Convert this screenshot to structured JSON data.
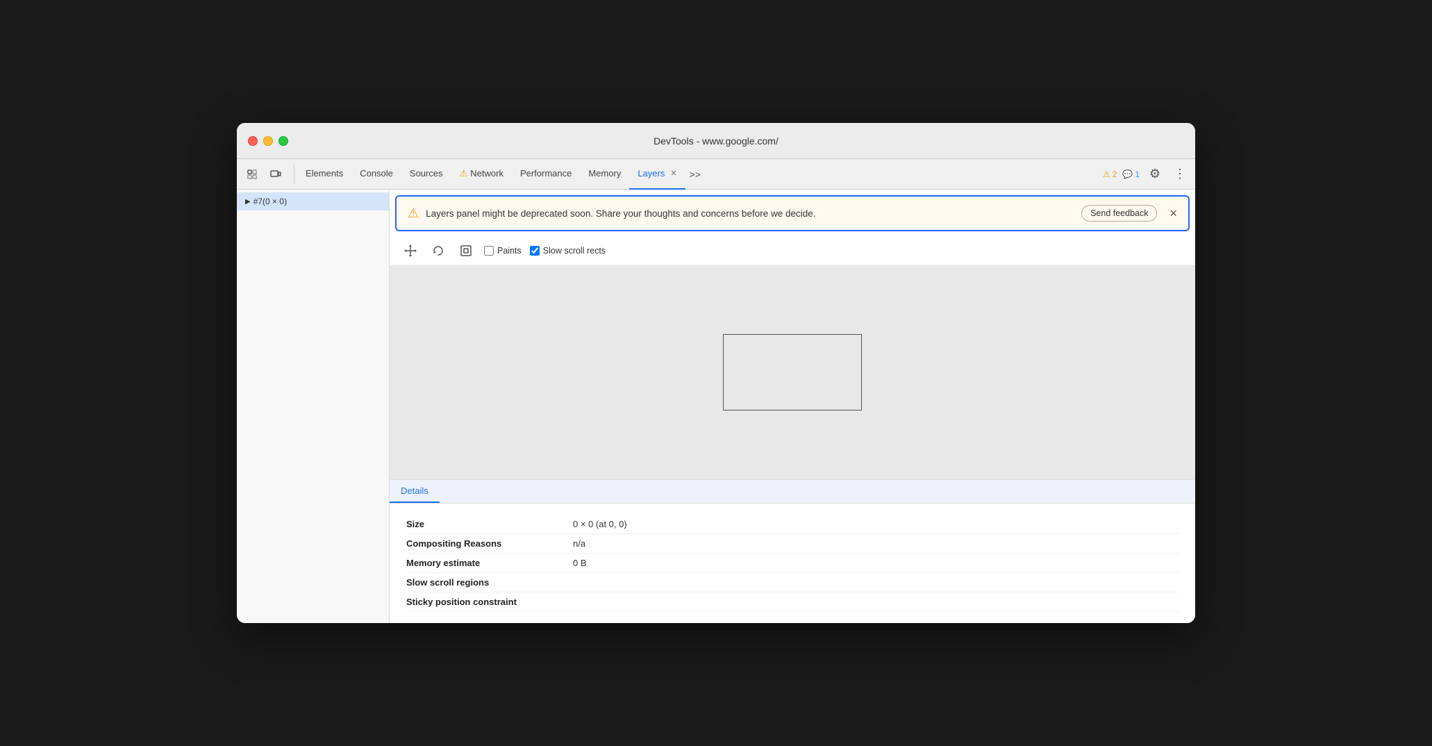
{
  "window": {
    "title": "DevTools - www.google.com/"
  },
  "tabs": {
    "items": [
      {
        "id": "elements",
        "label": "Elements",
        "active": false,
        "warning": false
      },
      {
        "id": "console",
        "label": "Console",
        "active": false,
        "warning": false
      },
      {
        "id": "sources",
        "label": "Sources",
        "active": false,
        "warning": false
      },
      {
        "id": "network",
        "label": "Network",
        "active": false,
        "warning": true
      },
      {
        "id": "performance",
        "label": "Performance",
        "active": false,
        "warning": false
      },
      {
        "id": "memory",
        "label": "Memory",
        "active": false,
        "warning": false
      },
      {
        "id": "layers",
        "label": "Layers",
        "active": true,
        "warning": false
      }
    ],
    "overflow_label": ">>",
    "warning_count": "2",
    "info_count": "1"
  },
  "sidebar": {
    "items": [
      {
        "id": "layer1",
        "label": "#7(0 × 0)",
        "selected": true
      }
    ]
  },
  "banner": {
    "text": "Layers panel might be deprecated soon. Share your thoughts and concerns before we decide.",
    "send_feedback_label": "Send feedback",
    "close_label": "×"
  },
  "layers_toolbar": {
    "tools": [
      {
        "id": "pan",
        "icon": "⊕",
        "label": "Pan"
      },
      {
        "id": "rotate",
        "icon": "↻",
        "label": "Rotate"
      },
      {
        "id": "reset",
        "icon": "⊡",
        "label": "Reset transform"
      }
    ],
    "paints_label": "Paints",
    "paints_checked": false,
    "slow_scroll_label": "Slow scroll rects",
    "slow_scroll_checked": true
  },
  "details": {
    "tab_label": "Details",
    "rows": [
      {
        "key": "Size",
        "value": "0 × 0 (at 0, 0)"
      },
      {
        "key": "Compositing Reasons",
        "value": "n/a"
      },
      {
        "key": "Memory estimate",
        "value": "0 B"
      },
      {
        "key": "Slow scroll regions",
        "value": ""
      },
      {
        "key": "Sticky position constraint",
        "value": ""
      }
    ]
  }
}
